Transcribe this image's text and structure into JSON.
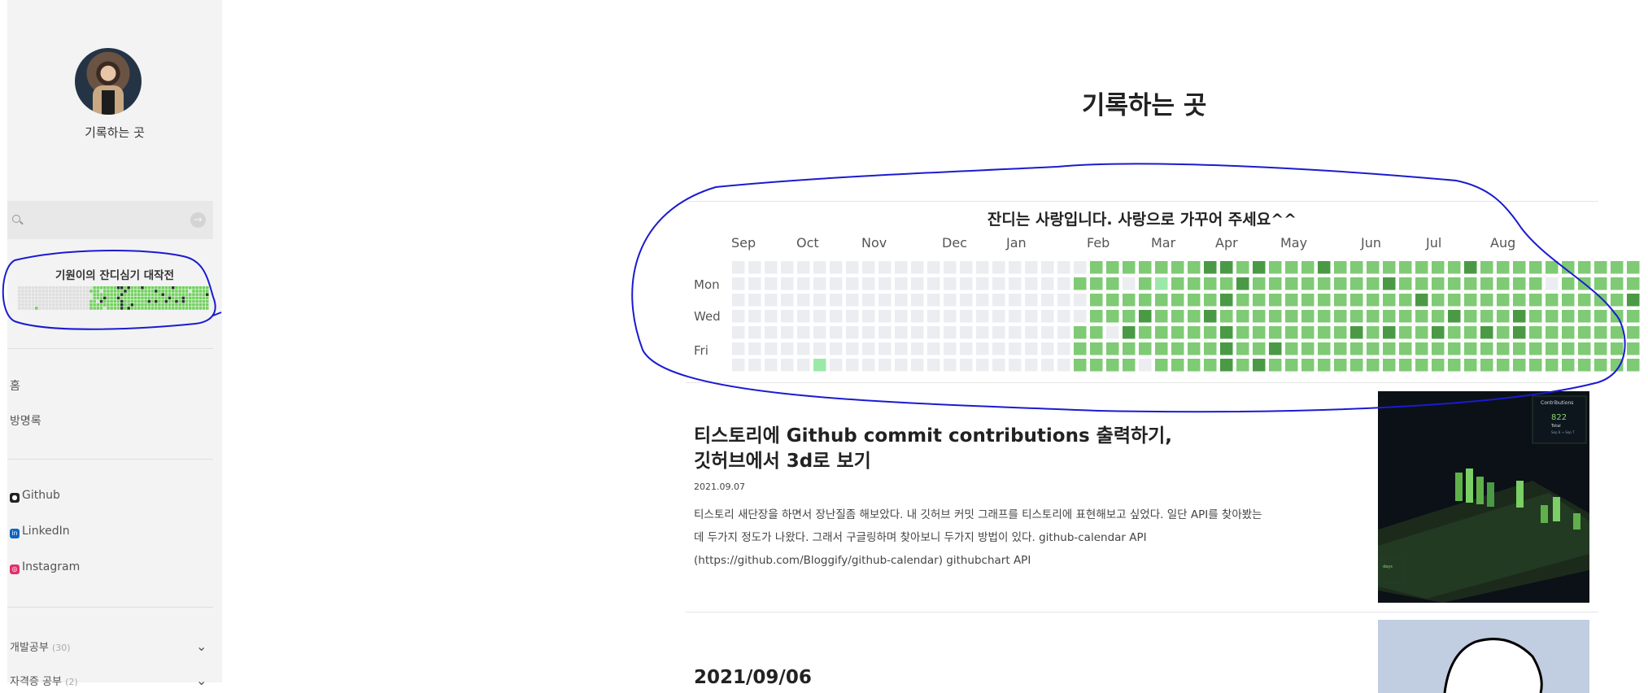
{
  "sidebar": {
    "blog_name": "기록하는 곳",
    "search": {
      "placeholder": "",
      "value": ""
    },
    "contrib_widget_title": "기원이의 잔디심기 대작전",
    "nav": [
      {
        "label": "홈"
      },
      {
        "label": "방명록"
      }
    ],
    "links": [
      {
        "label": "Github",
        "icon": "github-icon",
        "color": "#222222"
      },
      {
        "label": "LinkedIn",
        "icon": "linkedin-icon",
        "color": "#0a66c2"
      },
      {
        "label": "Instagram",
        "icon": "instagram-icon",
        "color": "#e1306c"
      }
    ],
    "categories": [
      {
        "label": "개발공부",
        "count": "(30)"
      },
      {
        "label": "자격증 공부",
        "count": "(2)"
      }
    ]
  },
  "main": {
    "title": "기록하는 곳",
    "calendar": {
      "title": "잔디는 사랑입니다. 사랑으로 가꾸어 주세요^^",
      "months": [
        "Sep",
        "Oct",
        "Nov",
        "Dec",
        "Jan",
        "Feb",
        "Mar",
        "Apr",
        "May",
        "Jun",
        "Jul",
        "Aug"
      ],
      "weekday_labels": [
        "Mon",
        "Wed",
        "Fri"
      ],
      "colors": {
        "level0": "#ebedf0",
        "level1": "#9be9a8",
        "level2": "#7fca74",
        "level3": "#4a9a45",
        "level4": "#2d6a2a"
      },
      "level_rows": [
        "00000000000000000000002222222332322232222222232222222222",
        "00000000000000000000022202122223222222223222222222022222",
        "00000000000000000000002222222232222222222232222222222223",
        "00000000000000000000002223222322222222222222322232222222",
        "00000000000000000000022032222232222222323223223232222222",
        "00000000000000000000022222222232232222222222222222222222",
        "00000100000000000000022220222232322222222222222222222222"
      ]
    },
    "posts": [
      {
        "title_line1": "티스토리에 Github commit contributions 출력하기,",
        "title_line2": "깃허브에서 3d로 보기",
        "date": "2021.09.07",
        "excerpt": "티스토리 새단장을 하면서 장난질좀 해보았다. 내 깃허브 커밋 그래프를 티스토리에 표현해보고 싶었다. 일단 API를 찾아봤는데 두가지 정도가 나왔다. 그래서 구글링하며 찾아보니 두가지 방법이 있다. github-calendar API (https://github.com/Bloggify/github-calendar) githubchart API",
        "thumbnail": {
          "panel_title": "Contributions",
          "total": "822",
          "total_label": "Total",
          "range": "Sep 6 → Sep 7",
          "days_label": "days"
        }
      },
      {
        "title_line1": "2021/09/06"
      }
    ]
  }
}
